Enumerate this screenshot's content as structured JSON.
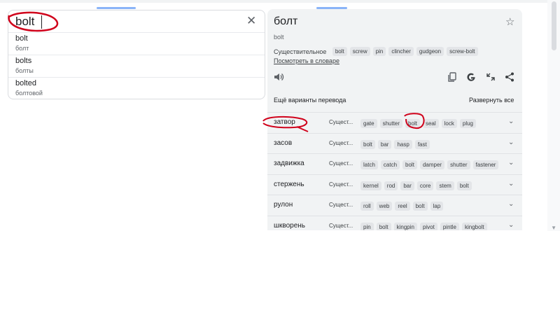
{
  "search": {
    "value": "bolt",
    "clear_icon": "close-icon"
  },
  "suggestions": [
    {
      "word": "bolt",
      "translation": "болт"
    },
    {
      "word": "bolts",
      "translation": "болты"
    },
    {
      "word": "bolted",
      "translation": "болтовой"
    }
  ],
  "result": {
    "title": "болт",
    "transliteration": "bolt",
    "part_of_speech": "Существительное",
    "synonyms": [
      "bolt",
      "screw",
      "pin",
      "clincher",
      "gudgeon",
      "screw-bolt"
    ],
    "dictionary_link": "Посмотреть в словаре",
    "icons": [
      "speaker-icon",
      "copy-icon",
      "google-icon",
      "feedback-icon",
      "share-icon",
      "star-icon"
    ]
  },
  "alternatives": {
    "header": "Ещё варианты перевода",
    "expand_all": "Развернуть все",
    "rows": [
      {
        "word": "затвор",
        "pos": "Сущест...",
        "chips": [
          "gate",
          "shutter",
          "bolt",
          "seal",
          "lock",
          "plug"
        ]
      },
      {
        "word": "засов",
        "pos": "Сущест...",
        "chips": [
          "bolt",
          "bar",
          "hasp",
          "fast"
        ]
      },
      {
        "word": "задвижка",
        "pos": "Сущест...",
        "chips": [
          "latch",
          "catch",
          "bolt",
          "damper",
          "shutter",
          "fastener"
        ]
      },
      {
        "word": "стержень",
        "pos": "Сущест...",
        "chips": [
          "kernel",
          "rod",
          "bar",
          "core",
          "stem",
          "bolt"
        ]
      },
      {
        "word": "рулон",
        "pos": "Сущест...",
        "chips": [
          "roll",
          "web",
          "reel",
          "bolt",
          "lap"
        ]
      },
      {
        "word": "шкворень",
        "pos": "Сущест...",
        "chips": [
          "pin",
          "bolt",
          "kingpin",
          "pivot",
          "pintle",
          "kingbolt"
        ]
      }
    ]
  },
  "colors": {
    "annotation": "#d0021b",
    "panel": "#f1f3f4",
    "chip": "#e3e5e8"
  }
}
